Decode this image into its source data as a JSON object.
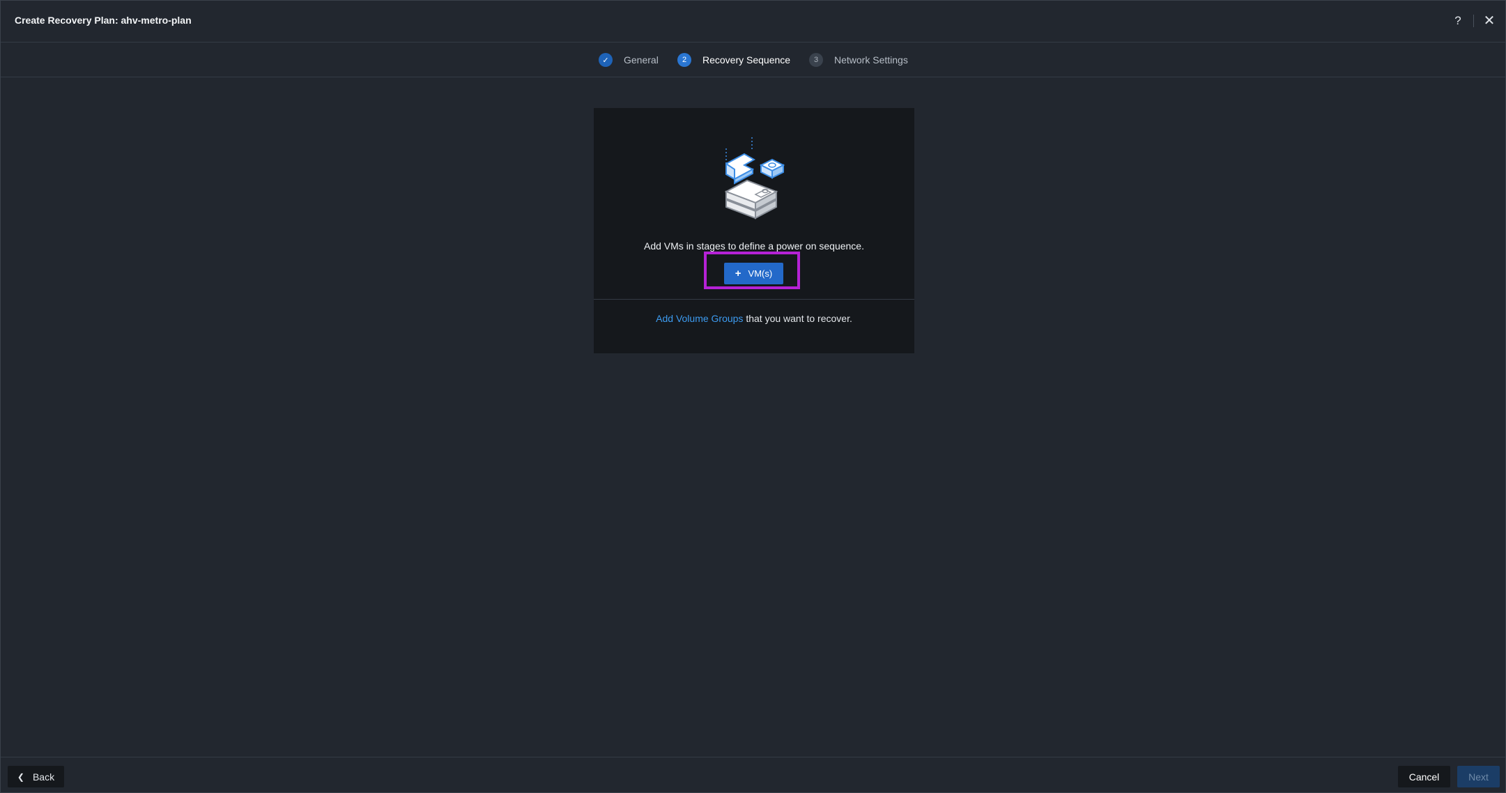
{
  "header": {
    "title": "Create Recovery Plan: ahv-metro-plan",
    "help_label": "?",
    "close_label": "✕"
  },
  "stepper": {
    "steps": [
      {
        "number": "✓",
        "label": "General",
        "state": "completed"
      },
      {
        "number": "2",
        "label": "Recovery Sequence",
        "state": "active"
      },
      {
        "number": "3",
        "label": "Network Settings",
        "state": "pending"
      }
    ]
  },
  "content": {
    "illustration_icon": "vm-stack-illustration",
    "stage_text": "Add VMs in stages to define a power on sequence.",
    "vm_button": {
      "icon": "+",
      "label": "VM(s)"
    },
    "volume_groups_link": "Add Volume Groups",
    "volume_groups_suffix": " that you want to recover."
  },
  "footer": {
    "back_label": "Back",
    "cancel_label": "Cancel",
    "next_label": "Next"
  },
  "colors": {
    "background": "#22272f",
    "panel": "#15181c",
    "primary": "#2369c9",
    "link": "#3d9bf0",
    "highlight": "#b522d6"
  }
}
